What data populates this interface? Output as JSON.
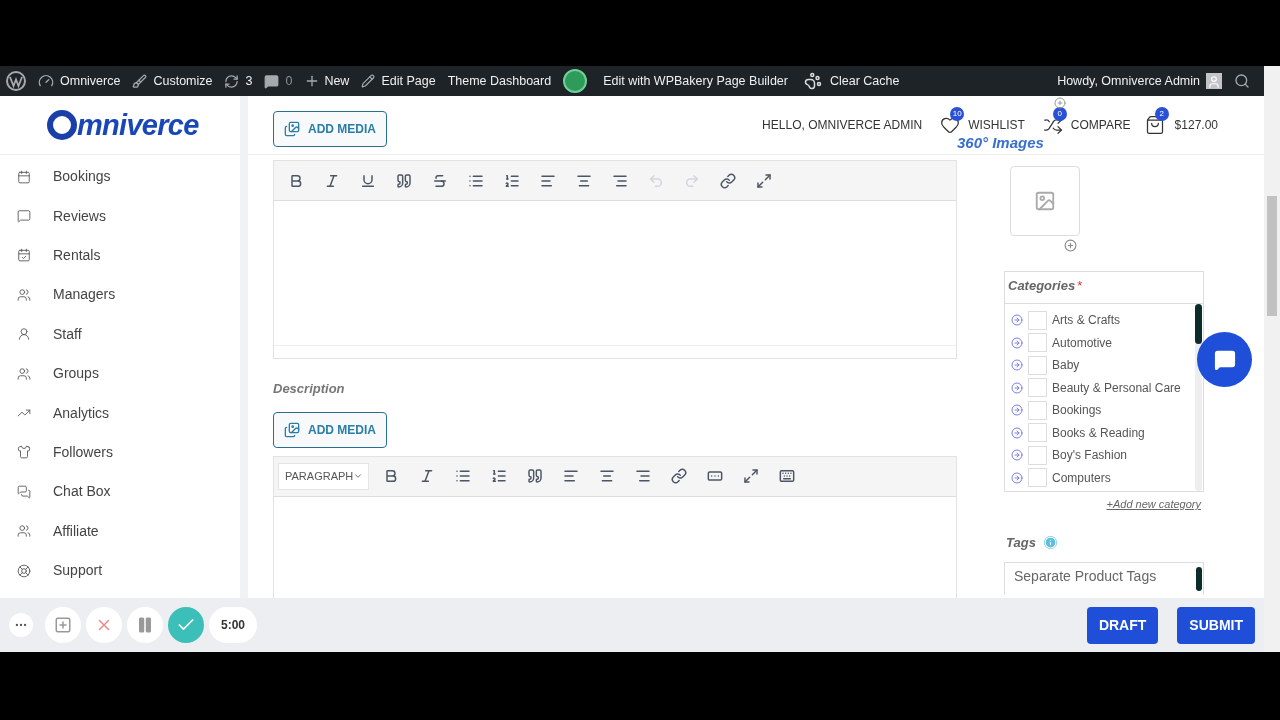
{
  "admin_bar": {
    "site": "Omniverce",
    "customize": "Customize",
    "updates": "3",
    "comments": "0",
    "new": "New",
    "edit_page": "Edit Page",
    "theme_dashboard": "Theme Dashboard",
    "page_builder": "Edit with WPBakery Page Builder",
    "clear_cache": "Clear Cache",
    "howdy": "Howdy, Omniverce Admin"
  },
  "header": {
    "logo": "mniverce",
    "greeting": "HELLO, OMNIVERCE ADMIN",
    "wishlist": {
      "label": "WISHLIST",
      "count": "10"
    },
    "compare": {
      "label": "COMPARE",
      "count": "0"
    },
    "cart": {
      "total": "$127.00",
      "count": "2"
    },
    "images_heading": "360° Images"
  },
  "sidebar": {
    "items": [
      {
        "label": "Bookings"
      },
      {
        "label": "Reviews"
      },
      {
        "label": "Rentals"
      },
      {
        "label": "Managers"
      },
      {
        "label": "Staff"
      },
      {
        "label": "Groups"
      },
      {
        "label": "Analytics"
      },
      {
        "label": "Followers"
      },
      {
        "label": "Chat Box"
      },
      {
        "label": "Affiliate"
      },
      {
        "label": "Support"
      }
    ]
  },
  "short_description": {
    "add_media": "ADD MEDIA",
    "undo_disabled": true,
    "redo_disabled": true
  },
  "description": {
    "label": "Description",
    "add_media": "ADD MEDIA",
    "format": "PARAGRAPH"
  },
  "categories": {
    "label": "Categories",
    "required": "*",
    "items": [
      {
        "label": "Arts & Crafts",
        "checked": false
      },
      {
        "label": "Automotive",
        "checked": false
      },
      {
        "label": "Baby",
        "checked": false
      },
      {
        "label": "Beauty & Personal Care",
        "checked": false
      },
      {
        "label": "Bookings",
        "checked": false
      },
      {
        "label": "Books & Reading",
        "checked": false
      },
      {
        "label": "Boy's Fashion",
        "checked": false
      },
      {
        "label": "Computers",
        "checked": false
      }
    ],
    "add_new": "+Add new category"
  },
  "tags": {
    "label": "Tags",
    "placeholder": "Separate Product Tags"
  },
  "actions": {
    "draft": "DRAFT",
    "submit": "SUBMIT"
  },
  "recorder": {
    "timer": "5:00"
  }
}
